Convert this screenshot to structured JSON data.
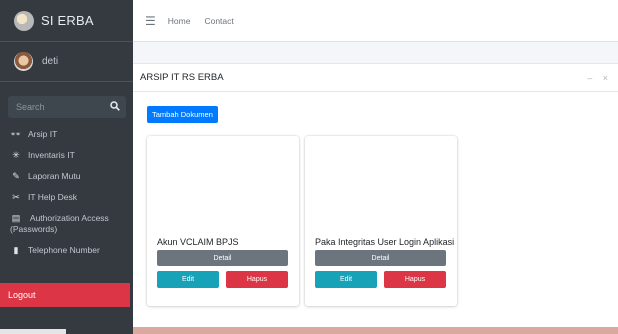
{
  "brand": {
    "title": "SI ERBA",
    "logo_icon": "leaf-logo-icon"
  },
  "user": {
    "name": "deti",
    "avatar_icon": "user-avatar-icon"
  },
  "sidebar": {
    "search_placeholder": "Search",
    "items": [
      {
        "label": "Arsip IT",
        "icon": "glasses-icon",
        "glyph": "👓"
      },
      {
        "label": "Inventaris IT",
        "icon": "bug-icon",
        "glyph": "✳"
      },
      {
        "label": "Laporan Mutu",
        "icon": "pen-icon",
        "glyph": "✎"
      },
      {
        "label": "IT Help Desk",
        "icon": "tools-icon",
        "glyph": "✂"
      },
      {
        "label": "Authorization Access (Passwords)",
        "icon": "document-icon",
        "glyph": "▤"
      },
      {
        "label": "Telephone Number",
        "icon": "phone-icon",
        "glyph": "▮"
      }
    ],
    "logout_label": "Logout",
    "logout_color": "#dc3545"
  },
  "topbar": {
    "links": [
      "Home",
      "Contact"
    ]
  },
  "card": {
    "title": "ARSIP IT RS ERBA",
    "tools": "– ×",
    "add_button": "Tambah Dokumen"
  },
  "documents": [
    {
      "title": "Akun VCLAIM BPJS",
      "detail": "Detail",
      "edit": "Edit",
      "delete": "Hapus"
    },
    {
      "title": "Paka Integritas User Login Aplikasi",
      "detail": "Detail",
      "edit": "Edit",
      "delete": "Hapus"
    }
  ],
  "colors": {
    "sidebar_bg": "#343a40",
    "primary": "#007bff",
    "info": "#17a2b8",
    "danger": "#dc3545",
    "secondary": "#6c757d"
  }
}
